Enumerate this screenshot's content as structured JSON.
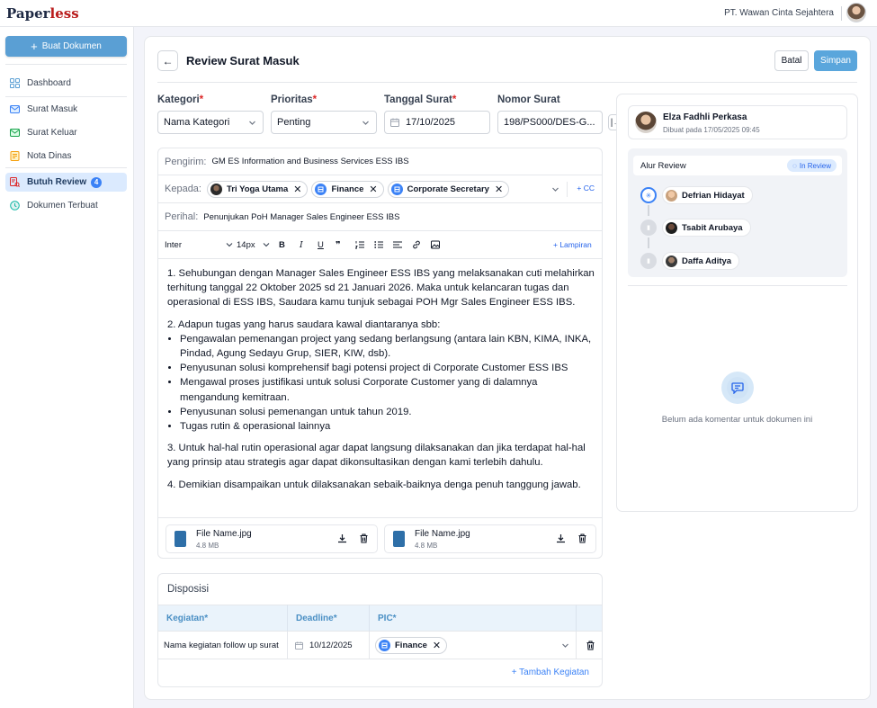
{
  "app": {
    "logo_main": "Paper",
    "logo_accent": "less",
    "company": "PT. Wawan Cinta Sejahtera"
  },
  "sidebar": {
    "new_button": "Buat Dokumen",
    "items": [
      {
        "label": "Dashboard",
        "icon": "grid-icon"
      },
      {
        "label": "Surat Masuk",
        "icon": "mail-in-icon"
      },
      {
        "label": "Surat Keluar",
        "icon": "mail-out-icon"
      },
      {
        "label": "Nota Dinas",
        "icon": "note-icon"
      },
      {
        "label": "Butuh Review",
        "icon": "review-icon",
        "badge": "4",
        "active": true
      },
      {
        "label": "Dokumen Terbuat",
        "icon": "history-icon"
      }
    ]
  },
  "header": {
    "title": "Review Surat Masuk",
    "cancel_label": "Batal",
    "save_label": "Simpan"
  },
  "form": {
    "kategori_label": "Kategori",
    "kategori_value": "Nama Kategori",
    "prioritas_label": "Prioritas",
    "prioritas_value": "Penting",
    "tanggal_label": "Tanggal Surat",
    "tanggal_value": "17/10/2025",
    "nomor_label": "Nomor Surat",
    "nomor_value": "198/PS000/DES-G..."
  },
  "mail": {
    "pengirim_label": "Pengirim:",
    "pengirim_value": "GM ES Information and Business Services ESS IBS",
    "kepada_label": "Kepada:",
    "recipients": [
      "Tri Yoga Utama",
      "Finance",
      "Corporate Secretary"
    ],
    "cc_label": "CC",
    "perihal_label": "Perihal:",
    "perihal_value": "Penunjukan PoH Manager Sales Engineer ESS IBS"
  },
  "editor": {
    "font": "Inter",
    "size": "14px",
    "attach_label": "Lampiran",
    "p1": "1. Sehubungan dengan Manager Sales Engineer ESS IBS yang melaksanakan cuti melahirkan terhitung tanggal 22 Oktober 2025 sd 21 Januari 2026. Maka untuk kelancaran tugas dan operasional di ESS IBS, Saudara kamu tunjuk sebagai POH Mgr Sales Engineer ESS IBS.",
    "p2": "2. Adapun tugas yang harus saudara kawal diantaranya sbb:",
    "bullets": [
      "Pengawalan pemenangan project yang sedang berlangsung (antara lain KBN, KIMA, INKA, Pindad, Agung Sedayu Grup, SIER, KIW, dsb).",
      "Penyusunan solusi komprehensif bagi potensi project di Corporate Customer ESS IBS",
      "Mengawal proses justifikasi untuk solusi Corporate Customer yang di dalamnya mengandung kemitraan.",
      "Penyusunan solusi pemenangan untuk tahun 2019.",
      "Tugas rutin & operasional lainnya"
    ],
    "p3": "3. Untuk hal-hal rutin operasional agar dapat langsung dilaksanakan dan jika terdapat hal-hal yang prinsip atau strategis agar dapat dikonsultasikan dengan kami terlebih dahulu.",
    "p4": "4. Demikian disampaikan untuk dilaksanakan sebaik-baiknya denga penuh tanggung jawab."
  },
  "attachments": [
    {
      "name": "File Name.jpg",
      "size": "4.8 MB"
    },
    {
      "name": "File Name.jpg",
      "size": "4.8 MB"
    }
  ],
  "disposisi": {
    "title": "Disposisi",
    "col_kegiatan": "Kegiatan",
    "col_deadline": "Deadline",
    "col_pic": "PIC",
    "row_kegiatan": "Nama kegiatan follow up surat",
    "row_deadline": "10/12/2025",
    "row_pic": "Finance",
    "add_label": "Tambah Kegiatan"
  },
  "review_panel": {
    "user_name": "Elza Fadhli Perkasa",
    "user_date": "Dibuat pada 17/05/2025 09:45",
    "flow_title": "Alur Review",
    "flow_status": "In Review",
    "steps": [
      "Defrian Hidayat",
      "Tsabit Arubaya",
      "Daffa Aditya"
    ],
    "no_comment": "Belum ada komentar untuk dokumen ini"
  },
  "colors": {
    "primary": "#5a9fd4",
    "accent_red": "#b91c1c",
    "active_nav_bg": "#dbeafe"
  }
}
